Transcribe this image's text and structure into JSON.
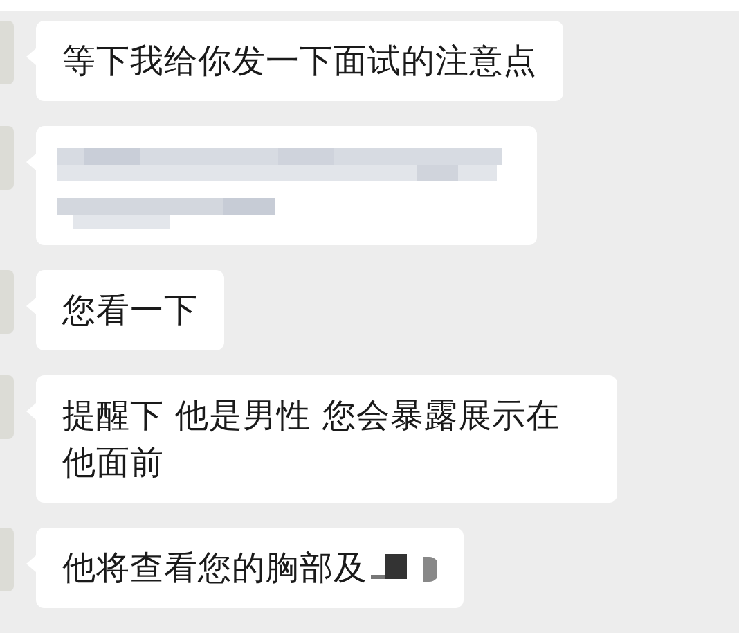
{
  "messages": [
    {
      "kind": "text",
      "text": "等下我给你发一下面试的注意点",
      "redacted_tail": false
    },
    {
      "kind": "redacted"
    },
    {
      "kind": "text",
      "text": "您看一下",
      "redacted_tail": false
    },
    {
      "kind": "text",
      "text": "提醒下 他是男性 您会暴露展示在他面前",
      "redacted_tail": false
    },
    {
      "kind": "text",
      "text": "他将查看您的胸部及",
      "redacted_tail": true
    }
  ]
}
